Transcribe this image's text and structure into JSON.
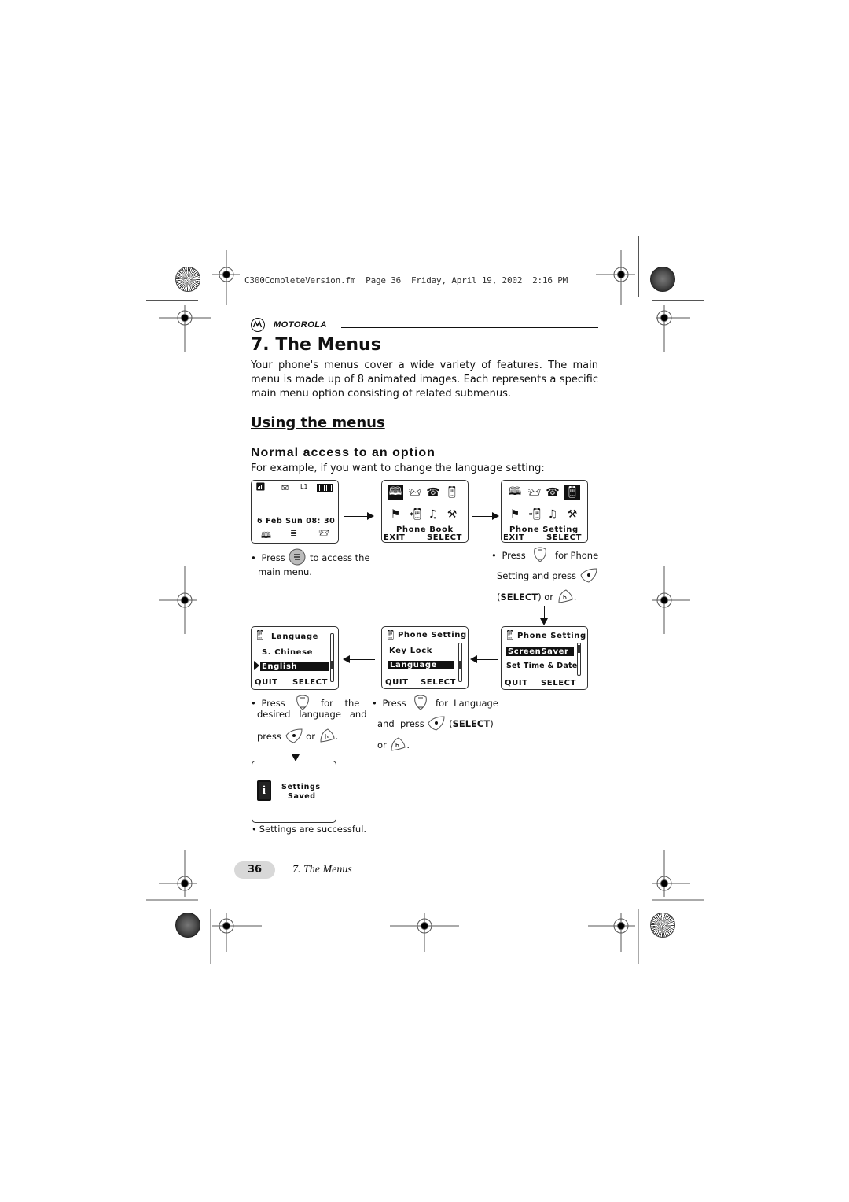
{
  "print_header": "C300CompleteVersion.fm  Page 36  Friday, April 19, 2002  2:16 PM",
  "brand": {
    "name": "MOTOROLA"
  },
  "title": "7. The Menus",
  "intro": "Your phone's menus cover a wide variety of features. The main menu is made up of 8 animated images. Each represents a specific main menu option consisting of related submenus.",
  "section_title": "Using the menus",
  "subsection_title": "Normal access to an option",
  "example_text": "For example, if you want to change the language setting:",
  "screens": {
    "idle": {
      "status_icons": [
        "signal-icon",
        "envelope-icon",
        "line-indicator",
        "battery-icon"
      ],
      "line_label": "L1",
      "datetime": "6 Feb Sun 08: 30",
      "softkey_icons": [
        "phonebook-icon",
        "menu-icon",
        "messages-icon"
      ]
    },
    "main_menu_phonebook": {
      "icons": [
        "phonebook-icon",
        "messages-icon",
        "call-log-icon",
        "phone-setting-icon",
        "network-icon",
        "handset-icon",
        "ringtone-icon",
        "tools-icon"
      ],
      "selected_index": 0,
      "label": "Phone Book",
      "left_softkey": "EXIT",
      "right_softkey": "SELECT"
    },
    "main_menu_setting": {
      "icons": [
        "phonebook-icon",
        "messages-icon",
        "call-log-icon",
        "phone-setting-icon",
        "network-icon",
        "handset-icon",
        "ringtone-icon",
        "tools-icon"
      ],
      "selected_index": 3,
      "label": "Phone Setting",
      "left_softkey": "EXIT",
      "right_softkey": "SELECT"
    },
    "setting_list_top": {
      "header": "Phone Setting",
      "items": [
        "ScreenSaver",
        "Set Time & Date"
      ],
      "selected_index": 0,
      "left_softkey": "QUIT",
      "right_softkey": "SELECT"
    },
    "setting_list_lang": {
      "header": "Phone Setting",
      "items": [
        "Key Lock",
        "Language"
      ],
      "selected_index": 1,
      "left_softkey": "QUIT",
      "right_softkey": "SELECT"
    },
    "language_list": {
      "header": "Language",
      "items": [
        "S. Chinese",
        "English"
      ],
      "selected_index": 1,
      "left_softkey": "QUIT",
      "right_softkey": "SELECT"
    },
    "saved": {
      "line1": "Settings",
      "line2": "Saved"
    }
  },
  "captions": {
    "step1": {
      "pre": "Press",
      "post": "to access the",
      "line2": "main menu."
    },
    "step2": {
      "pre": "Press",
      "mid": "for  Phone",
      "line2": "Setting and press",
      "line3_bold": "SELECT",
      "line3_or": "or"
    },
    "step3": {
      "pre": "Press",
      "mid": "for  Language",
      "line2": "and  press",
      "line2_bold": "SELECT",
      "line3": "or"
    },
    "step4": {
      "pre": "Press",
      "mid": "for    the",
      "line2": "desired   language   and",
      "line3": "press",
      "line3_or": "or"
    },
    "step5": {
      "text": "Settings are successful."
    }
  },
  "footer": {
    "page_number": "36",
    "chapter": "7. The Menus"
  }
}
